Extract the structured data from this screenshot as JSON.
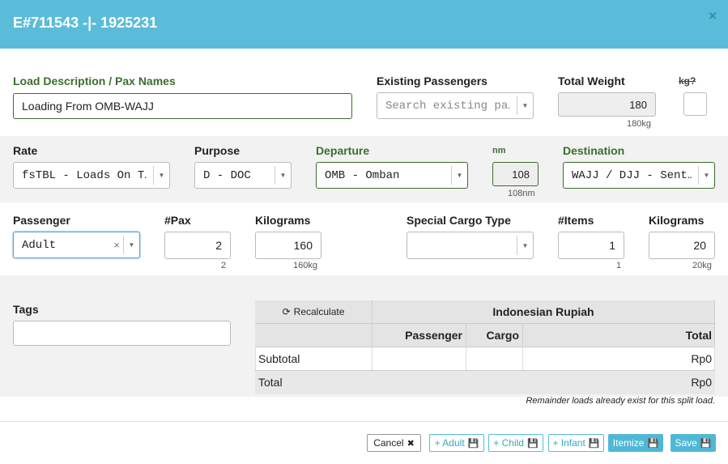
{
  "modal": {
    "title": "E#711543 -|- 1925231",
    "close": "×"
  },
  "load": {
    "label": "Load Description / Pax Names",
    "value": "Loading From OMB-WAJJ"
  },
  "existing_passengers": {
    "label": "Existing Passengers",
    "placeholder": "Search existing pa…"
  },
  "total_weight": {
    "label": "Total Weight",
    "value": "180",
    "hint": "180kg"
  },
  "kg_toggle": {
    "label": "kg?"
  },
  "rate": {
    "label": "Rate",
    "value": "fsTBL - Loads On T…"
  },
  "purpose": {
    "label": "Purpose",
    "value": "D - DOC"
  },
  "departure": {
    "label": "Departure",
    "value": "OMB - Omban"
  },
  "distance": {
    "label": "nm",
    "value": "108",
    "hint": "108nm"
  },
  "destination": {
    "label": "Destination",
    "value": "WAJJ / DJJ - Sent…"
  },
  "passenger": {
    "label": "Passenger",
    "value": "Adult",
    "clear": "×"
  },
  "pax": {
    "label": "#Pax",
    "value": "2",
    "hint": "2"
  },
  "pax_kilograms": {
    "label": "Kilograms",
    "value": "160",
    "hint": "160kg"
  },
  "special_cargo": {
    "label": "Special Cargo Type",
    "value": ""
  },
  "items": {
    "label": "#Items",
    "value": "1",
    "hint": "1"
  },
  "cargo_kilograms": {
    "label": "Kilograms",
    "value": "20",
    "hint": "20kg"
  },
  "tags": {
    "label": "Tags",
    "value": ""
  },
  "pricing": {
    "recalculate": "Recalculate",
    "currency": "Indonesian Rupiah",
    "columns": [
      "Passenger",
      "Cargo",
      "Total"
    ],
    "subtotal": {
      "label": "Subtotal",
      "passenger": "",
      "cargo": "",
      "total": "Rp0"
    },
    "total": {
      "label": "Total",
      "value": "Rp0"
    }
  },
  "note": "Remainder loads already exist for this split load.",
  "buttons": {
    "cancel": "Cancel",
    "add_adult": "+ Adult",
    "add_child": "+ Child",
    "add_infant": "+ Infant",
    "itemize": "Itemize",
    "save": "Save"
  },
  "colors": {
    "header": "#5bbcd9",
    "label_green": "#3b6e2d",
    "button_accent": "#4fb8d6"
  }
}
